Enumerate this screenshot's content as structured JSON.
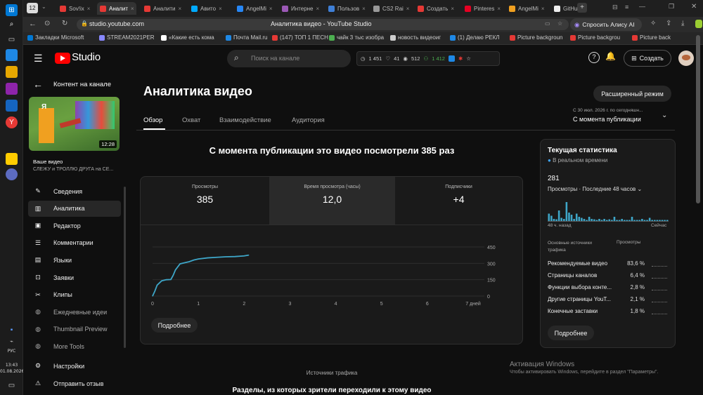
{
  "taskbar": {
    "tab_count": "12",
    "lang": "РУС",
    "time": "13:43",
    "date": "01.08.2026"
  },
  "browser": {
    "tabs": [
      {
        "label": "Sov!ix",
        "color": "#e53935"
      },
      {
        "label": "Аналит",
        "color": "#e53935",
        "active": true
      },
      {
        "label": "Аналити",
        "color": "#e53935"
      },
      {
        "label": "Авито",
        "color": "#00aaff"
      },
      {
        "label": "AngelMi",
        "color": "#2787f5"
      },
      {
        "label": "Интерне",
        "color": "#9b59b6"
      },
      {
        "label": "Пользов",
        "color": "#3f7fd6"
      },
      {
        "label": "CS2 Rai",
        "color": "#999999"
      },
      {
        "label": "Создать",
        "color": "#e53935"
      },
      {
        "label": "Pinteres",
        "color": "#e60023"
      },
      {
        "label": "AngelMi",
        "color": "#f0a020"
      },
      {
        "label": "GitHub",
        "color": "#eeeeee"
      }
    ],
    "url": "studio.youtube.com",
    "page_title": "Аналитика видео - YouTube Studio",
    "alice_button": "Спросить Алису AI",
    "bookmarks": [
      "Закладки Microsoft",
      "STREAM2021PER",
      "«Какие есть кома",
      "Почта Mail.ru",
      "(147) ТОП 1 ПЕСН",
      "чайк 3 тыс изобра",
      "новость видеоиг",
      "(1) Делаю РЕКЛ",
      "Picture backgroun",
      "Picture backgrou",
      "Picture back"
    ]
  },
  "studio": {
    "logo_text": "Studio",
    "search_placeholder": "Поиск на канале",
    "stats": {
      "views": "1 451",
      "likes": "41",
      "eye": "512",
      "subs": "1 412"
    },
    "create_label": "Создать"
  },
  "sidebar": {
    "back_label": "Контент на канале",
    "thumb_duration": "12:28",
    "thumb_badge": "Я",
    "your_video": "Ваше видео",
    "video_title": "СЛЕЖУ и ТРОЛЛЮ ДРУГА на СЕ...",
    "items": [
      {
        "label": "Сведения",
        "icon": "pencil-icon"
      },
      {
        "label": "Аналитика",
        "icon": "analytics-icon",
        "active": true
      },
      {
        "label": "Редактор",
        "icon": "editor-icon"
      },
      {
        "label": "Комментарии",
        "icon": "comment-icon"
      },
      {
        "label": "Языки",
        "icon": "languages-icon"
      },
      {
        "label": "Заявки",
        "icon": "claims-icon"
      },
      {
        "label": "Клипы",
        "icon": "scissors-icon"
      },
      {
        "label": "Ежедневные идеи",
        "icon": "ideas-icon",
        "dim": true
      },
      {
        "label": "Thumbnail Preview",
        "icon": "preview-icon",
        "dim": true
      },
      {
        "label": "More Tools",
        "icon": "tools-icon",
        "dim": true
      }
    ],
    "settings": "Настройки",
    "feedback": "Отправить отзыв"
  },
  "main": {
    "title": "Аналитика видео",
    "advanced_button": "Расширенный режим",
    "tabs": [
      "Обзор",
      "Охват",
      "Взаимодействие",
      "Аудитория"
    ],
    "period_small": "С 30 июл. 2026 г. по сегодняшн...",
    "period": "С момента публикации",
    "headline": "С момента публикации это видео посмотрели 385 раз",
    "metrics": [
      {
        "label": "Просмотры",
        "value": "385"
      },
      {
        "label": "Время просмотра (часы)",
        "value": "12,0"
      },
      {
        "label": "Подписчики",
        "value": "+4"
      }
    ],
    "more_button": "Подробнее",
    "traffic_label": "Источники трафика",
    "traffic_heading": "Разделы, из которых зрители переходили к этому видео"
  },
  "chart_data": {
    "type": "line",
    "x_ticks": [
      "0",
      "1",
      "2",
      "3",
      "4",
      "5",
      "6",
      "7 дней"
    ],
    "y_ticks": [
      "0",
      "150",
      "300",
      "450"
    ],
    "ylim": [
      0,
      450
    ],
    "xlim": [
      0,
      7
    ],
    "x": [
      0,
      0.05,
      0.1,
      0.2,
      0.3,
      0.4,
      0.45,
      0.5,
      0.6,
      0.7,
      0.8,
      0.9,
      1.0,
      1.2,
      1.4,
      1.6,
      1.8,
      2.0,
      2.1
    ],
    "values": [
      0,
      45,
      100,
      140,
      150,
      152,
      190,
      240,
      295,
      305,
      315,
      330,
      340,
      350,
      355,
      360,
      362,
      368,
      375
    ],
    "color": "#3ea6c8"
  },
  "realtime": {
    "title": "Текущая статистика",
    "live": "В реальном времени",
    "count": "281",
    "sublabel": "Просмотры · Последние 48 часов",
    "left_label": "48 ч. назад",
    "right_label": "Сейчас",
    "bars": [
      0.35,
      0.25,
      0.1,
      0.08,
      0.5,
      0.15,
      0.1,
      0.9,
      0.4,
      0.3,
      0.1,
      0.35,
      0.2,
      0.15,
      0.1,
      0.05,
      0.2,
      0.1,
      0.08,
      0.05,
      0.1,
      0.05,
      0.1,
      0.05,
      0.08,
      0.05,
      0.2,
      0.05,
      0.05,
      0.1,
      0.05,
      0.05,
      0.05,
      0.2,
      0.05,
      0.05,
      0.05,
      0.1,
      0.05,
      0.05,
      0.15,
      0.05,
      0.05,
      0.05,
      0.05,
      0.05,
      0.05,
      0.05
    ],
    "col1": "Основные источники трафика",
    "col2": "Просмотры",
    "sources": [
      {
        "name": "Рекомендуемые видео",
        "pct": "83,6 %"
      },
      {
        "name": "Страницы каналов",
        "pct": "6,4 %"
      },
      {
        "name": "Функции выбора конте...",
        "pct": "2,8 %"
      },
      {
        "name": "Другие страницы YouT...",
        "pct": "2,1 %"
      },
      {
        "name": "Конечные заставки",
        "pct": "1,8 %"
      }
    ],
    "more_button": "Подробнее"
  },
  "watermark": {
    "title": "Активация Windows",
    "text": "Чтобы активировать Windows, перейдите в раздел \"Параметры\"."
  }
}
